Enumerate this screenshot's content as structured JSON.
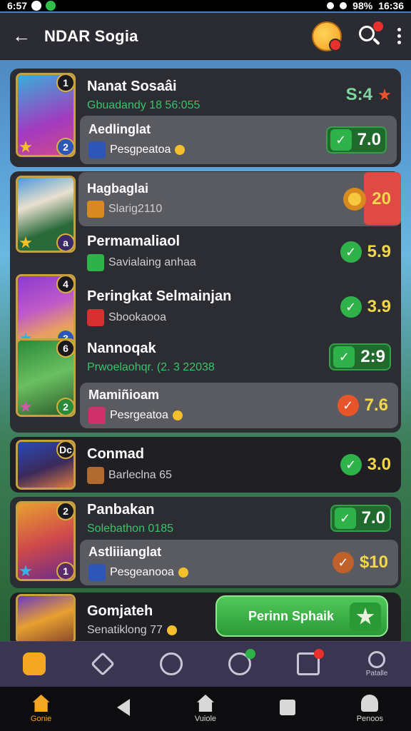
{
  "status": {
    "time_left": "6:57",
    "battery": "98%",
    "time_right": "16:36"
  },
  "appbar": {
    "title": "NDAR Sogia"
  },
  "rows": [
    {
      "name": "Nanat Sosaâi",
      "sub": "Gbuadandy 18 56:055",
      "value": "S:4",
      "badge_top": "1",
      "badge_bottom": "2"
    },
    {
      "name": "Aedlinglat",
      "sub": "Pesgpeatoa",
      "value": "7.0"
    },
    {
      "name": "Hagbaglai",
      "sub": "Slarig2110",
      "value": "20",
      "badge_bottom": "a"
    },
    {
      "name": "Permamaliaol",
      "sub": "Savialaing anhaa",
      "value": "5.9"
    },
    {
      "name": "Peringkat Selmainjan",
      "sub": "Sbookaooa",
      "value": "3.9",
      "badge_top": "4",
      "badge_bottom": "3"
    },
    {
      "name": "Nannoqak",
      "sub": "Prwoelaohqr. (2. 3 22038",
      "value": "2:9",
      "badge_top": "6",
      "badge_bottom": "2"
    },
    {
      "name": "Mamiñioam",
      "sub": "Pesrgeatoa",
      "value": "7.6"
    },
    {
      "name": "Conmad",
      "sub": "Barleclna 65",
      "value": "3.0",
      "badge_top": "Dc"
    },
    {
      "name": "Panbakan",
      "sub": "Solebathon 0185",
      "value": "7.0",
      "badge_top": "2",
      "badge_bottom": "1"
    },
    {
      "name": "Astliiianglat",
      "sub": "Pesgeanooa",
      "value": "$10"
    },
    {
      "name": "Gomjateh",
      "sub": "Senatiklong 77"
    }
  ],
  "cta": {
    "label": "Perinn Sphaik"
  },
  "tabs": [
    {
      "label": ""
    },
    {
      "label": ""
    },
    {
      "label": ""
    },
    {
      "label": ""
    },
    {
      "label": ""
    },
    {
      "label": "Patalle"
    }
  ],
  "nav": [
    {
      "label": "Gonie"
    },
    {
      "label": ""
    },
    {
      "label": "Vuiole"
    },
    {
      "label": ""
    },
    {
      "label": "Penoos"
    }
  ],
  "colors": {
    "accent": "#f5a623",
    "check_green": "#2fb24a",
    "value_yellow": "#f1d54a",
    "card_bg": "#2c2d33"
  }
}
